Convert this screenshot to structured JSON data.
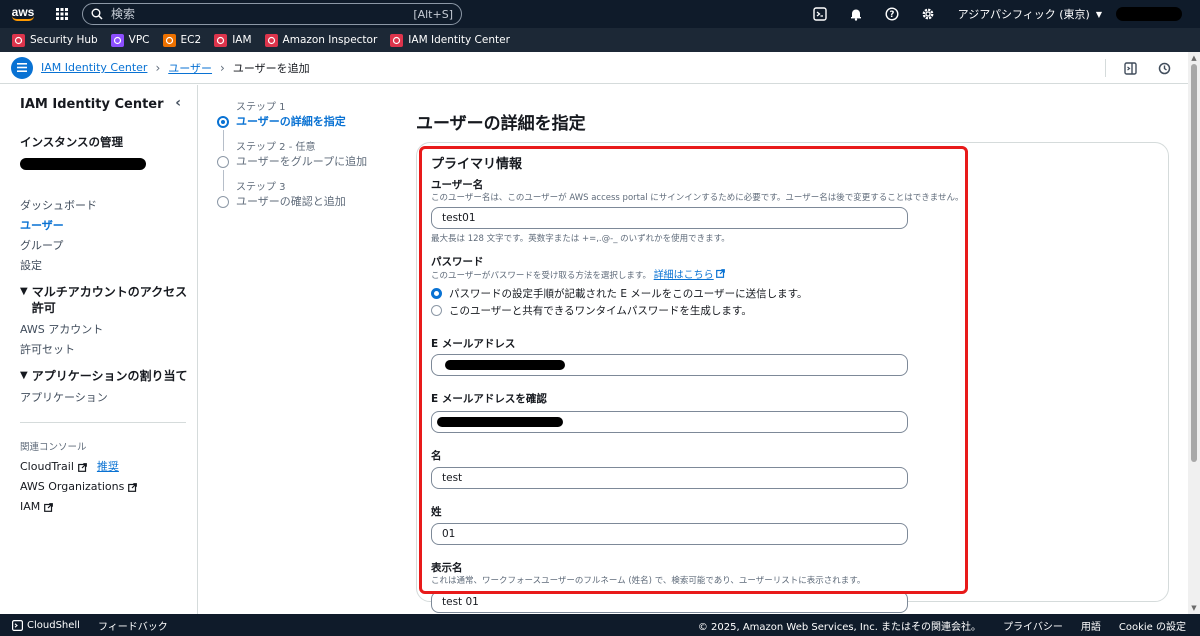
{
  "topnav": {
    "logo": "aws",
    "search_placeholder": "検索",
    "search_shortcut": "[Alt+S]",
    "region": "アジアパシフィック (東京)"
  },
  "favorites": [
    {
      "label": "Security Hub",
      "color": "#dd344c"
    },
    {
      "label": "VPC",
      "color": "#8c4fff"
    },
    {
      "label": "EC2",
      "color": "#ed7100"
    },
    {
      "label": "IAM",
      "color": "#dd344c"
    },
    {
      "label": "Amazon Inspector",
      "color": "#dd344c"
    },
    {
      "label": "IAM Identity Center",
      "color": "#dd344c"
    }
  ],
  "breadcrumb": {
    "items": [
      "IAM Identity Center",
      "ユーザー"
    ],
    "current": "ユーザーを追加"
  },
  "sidebar": {
    "title": "IAM Identity Center",
    "instance_heading": "インスタンスの管理",
    "links": [
      "ダッシュボード",
      "ユーザー",
      "グループ",
      "設定"
    ],
    "active_link": "ユーザー",
    "section1": "マルチアカウントのアクセス許可",
    "section1_links": [
      "AWS アカウント",
      "許可セット"
    ],
    "section2": "アプリケーションの割り当て",
    "section2_links": [
      "アプリケーション"
    ],
    "related_label": "関連コンソール",
    "cloudtrail": "CloudTrail",
    "recommended": "推奨",
    "organizations": "AWS Organizations",
    "iam": "IAM"
  },
  "steps": [
    {
      "num": "ステップ 1",
      "name": "ユーザーの詳細を指定",
      "active": true
    },
    {
      "num": "ステップ 2 - 任意",
      "name": "ユーザーをグループに追加",
      "active": false
    },
    {
      "num": "ステップ 3",
      "name": "ユーザーの確認と追加",
      "active": false
    }
  ],
  "main": {
    "title": "ユーザーの詳細を指定",
    "section_title": "プライマリ情報",
    "username_label": "ユーザー名",
    "username_desc": "このユーザー名は、このユーザーが AWS access portal にサインインするために必要です。ユーザー名は後で変更することはできません。",
    "username_value": "test01",
    "username_hint": "最大長は 128 文字です。英数字または +=,.@-_ のいずれかを使用できます。",
    "password_label": "パスワード",
    "password_desc": "このユーザーがパスワードを受け取る方法を選択します。",
    "password_link": "詳細はこちら",
    "radio1": "パスワードの設定手順が記載された E メールをこのユーザーに送信します。",
    "radio2": "このユーザーと共有できるワンタイムパスワードを生成します。",
    "email_label": "E メールアドレス",
    "email_confirm_label": "E メールアドレスを確認",
    "first_name_label": "名",
    "first_name_value": "test",
    "last_name_label": "姓",
    "last_name_value": "01",
    "display_name_label": "表示名",
    "display_name_desc": "これは通常、ワークフォースユーザーのフルネーム (姓名) で、検索可能であり、ユーザーリストに表示されます。",
    "display_name_value": "test 01"
  },
  "footer": {
    "cloudshell": "CloudShell",
    "feedback": "フィードバック",
    "copyright": "© 2025, Amazon Web Services, Inc. またはその関連会社。",
    "privacy": "プライバシー",
    "terms": "用語",
    "cookie": "Cookie の設定"
  }
}
